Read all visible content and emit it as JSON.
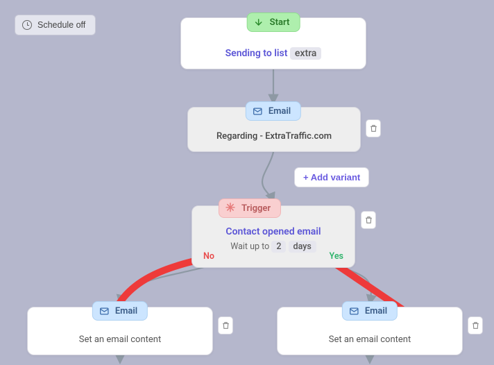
{
  "schedule": {
    "label": "Schedule off"
  },
  "pills": {
    "start": "Start",
    "email": "Email",
    "trigger": "Trigger"
  },
  "start": {
    "text_prefix": "Sending to list",
    "text_chip": "extra"
  },
  "email1": {
    "subject": "Regarding - ExtraTraffic.com"
  },
  "add_variant": {
    "label": "+ Add variant"
  },
  "trigger": {
    "title": "Contact opened email",
    "wait_prefix": "Wait up to",
    "wait_value": "2",
    "wait_unit": "days",
    "no": "No",
    "yes": "Yes"
  },
  "email_children": {
    "placeholder": "Set an email content"
  }
}
